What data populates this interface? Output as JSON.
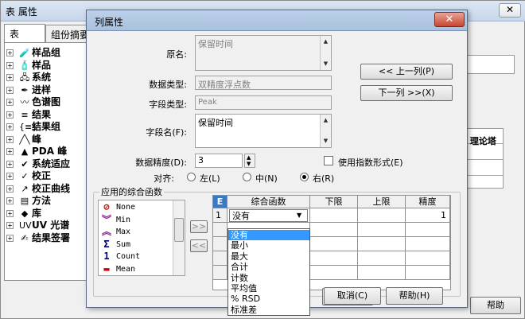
{
  "bg_window": {
    "title": "表 属性",
    "close": "✕",
    "tabs": [
      "表",
      "组份摘要"
    ],
    "tree": [
      {
        "icon": "🧪",
        "label": "样品组"
      },
      {
        "icon": "🧴",
        "label": "样品"
      },
      {
        "icon": "🖧",
        "label": "系统"
      },
      {
        "icon": "✒",
        "label": "进样"
      },
      {
        "icon": "〰",
        "label": "色谱图"
      },
      {
        "icon": "≡",
        "label": "结果"
      },
      {
        "icon": "{≡}",
        "label": "结果组"
      },
      {
        "icon": "╱╲",
        "label": "峰"
      },
      {
        "icon": "▲",
        "label": "PDA 峰"
      },
      {
        "icon": "✔",
        "label": "系统适应"
      },
      {
        "icon": "✓",
        "label": "校正"
      },
      {
        "icon": "↗",
        "label": "校正曲线"
      },
      {
        "icon": "▤",
        "label": "方法"
      },
      {
        "icon": "◆",
        "label": "库"
      },
      {
        "icon": "UV",
        "label": "UV 光谱"
      },
      {
        "icon": "✍",
        "label": "结果签署"
      }
    ],
    "grid_text": "P 理论塔",
    "help": "帮助"
  },
  "dialog": {
    "title": "列属性",
    "close": "✕",
    "original_name_label": "原名:",
    "original_name": "保留时间",
    "data_type_label": "数据类型:",
    "data_type": "双精度浮点数",
    "field_type_label": "字段类型:",
    "field_type": "Peak",
    "field_name_label": "字段名(F):",
    "field_name": "保留时间",
    "precision_label": "数据精度(D):",
    "precision": "3",
    "exponent_label": "使用指数形式(E)",
    "align_label": "对齐:",
    "align_left": "左(L)",
    "align_center": "中(N)",
    "align_right": "右(R)",
    "prev_column": "<< 上一列(P)",
    "next_column": "下一列 >>(X)",
    "group_title": "应用的综合函数",
    "functions": [
      {
        "icon": "⊘",
        "color": "#d00000",
        "label": "None"
      },
      {
        "icon": "︾",
        "color": "#8a2a8a",
        "label": "Min"
      },
      {
        "icon": "︽",
        "color": "#8a2a8a",
        "label": "Max"
      },
      {
        "icon": "Σ",
        "color": "#000080",
        "label": "Sum"
      },
      {
        "icon": "1",
        "color": "#000080",
        "label": "Count"
      },
      {
        "icon": "▬",
        "color": "#d00000",
        "label": "Mean"
      }
    ],
    "add_arrow": ">>",
    "remove_arrow": "<<",
    "table": {
      "corner": "E",
      "headers": [
        "综合函数",
        "下限",
        "上限",
        "精度"
      ],
      "row_index": "1",
      "function_value": "没有",
      "precision_value": "1"
    },
    "dropdown_options": [
      "没有",
      "最小",
      "最大",
      "合计",
      "计数",
      "平均值",
      "% RSD",
      "标准差"
    ],
    "cancel": "取消(C)",
    "help": "帮助(H)"
  }
}
